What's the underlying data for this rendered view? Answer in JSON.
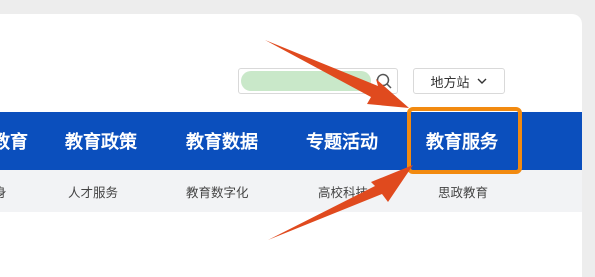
{
  "header": {
    "search": {
      "placeholder": "",
      "icon": "search-icon"
    },
    "region_button": {
      "label": "地方站",
      "icon": "chevron-down-icon"
    }
  },
  "nav": {
    "items": [
      {
        "label": "教育"
      },
      {
        "label": "教育政策"
      },
      {
        "label": "教育数据"
      },
      {
        "label": "专题活动"
      },
      {
        "label": "教育服务"
      }
    ],
    "highlighted": "教育服务",
    "highlight_color": "#f28a10",
    "bar_color": "#0b4fbd"
  },
  "subnav": {
    "items": [
      {
        "label": "身"
      },
      {
        "label": "人才服务"
      },
      {
        "label": "教育数字化"
      },
      {
        "label": "高校科技"
      },
      {
        "label": "思政教育"
      }
    ]
  },
  "annotation": {
    "arrow_color": "#e04a1e"
  }
}
